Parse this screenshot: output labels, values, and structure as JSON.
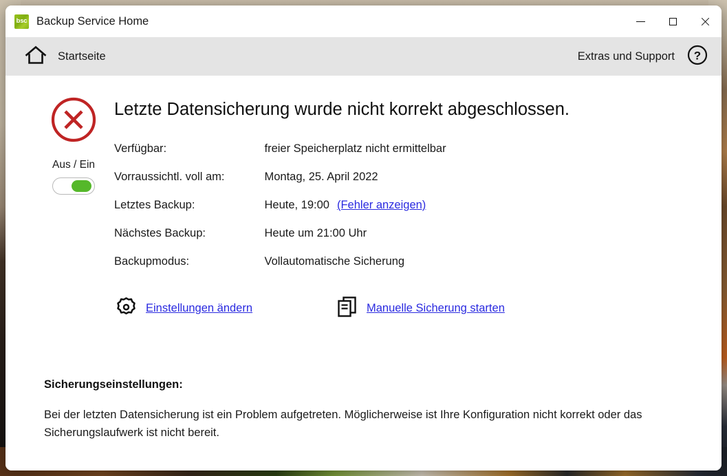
{
  "window": {
    "title": "Backup Service Home",
    "logo_text": "bsc",
    "controls": {
      "minimize": "minimize-button",
      "maximize": "maximize-button",
      "close": "close-button"
    }
  },
  "toolbar": {
    "home_label": "Startseite",
    "home_icon": "home-icon",
    "support_label": "Extras und Support",
    "support_icon": "help-circle-icon"
  },
  "status": {
    "icon": "error-circle-x-icon",
    "heading": "Letzte Datensicherung wurde nicht korrekt abgeschlossen.",
    "power_label": "Aus / Ein",
    "power_state": "on"
  },
  "details": [
    {
      "label": "Verfügbar:",
      "value": "freier Speicherplatz nicht ermittelbar",
      "link": null
    },
    {
      "label": "Vorraussichtl. voll am:",
      "value": "Montag, 25. April 2022",
      "link": null
    },
    {
      "label": "Letztes Backup:",
      "value": "Heute, 19:00",
      "link": "(Fehler anzeigen)"
    },
    {
      "label": "Nächstes Backup:",
      "value": "Heute um 21:00 Uhr",
      "link": null
    },
    {
      "label": "Backupmodus:",
      "value": "Vollautomatische Sicherung",
      "link": null
    }
  ],
  "actions": [
    {
      "icon": "gear-icon",
      "label": "Einstellungen ändern"
    },
    {
      "icon": "copy-documents-icon",
      "label": "Manuelle Sicherung starten"
    }
  ],
  "notes": {
    "title": "Sicherungseinstellungen:",
    "text": "Bei der letzten Datensicherung ist ein Problem aufgetreten. Möglicherweise ist Ihre Konfiguration nicht korrekt oder das Sicherungslaufwerk ist nicht bereit."
  },
  "colors": {
    "error_red": "#bf2424",
    "link_blue": "#2a2ae0",
    "toggle_green": "#55b82a",
    "logo_green": "#8cba18",
    "toolbar_gray": "#e4e4e4"
  }
}
